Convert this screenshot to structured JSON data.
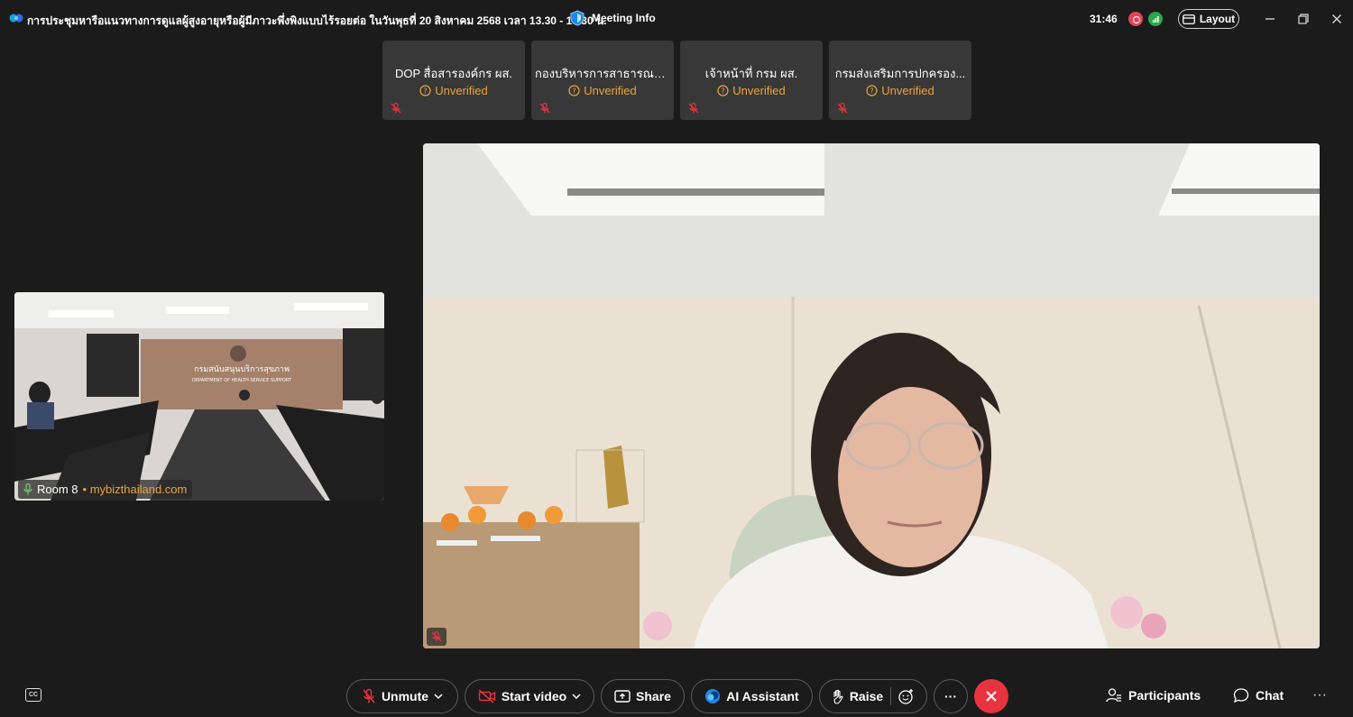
{
  "window": {
    "title": "การประชุมหารือแนวทางการดูแลผู้สูงอายุหรือผู้มีภาวะพึ่งพิงแบบไร้รอยต่อ ในวันพุธที่ 20 สิงหาคม 2568 เวลา 13.30 - 16.30 น.",
    "meeting_info_label": "Meeting Info",
    "timer": "31:46",
    "layout_label": "Layout",
    "minimize_icon": "minimize-icon",
    "restore_icon": "restore-icon",
    "close_icon": "close-icon"
  },
  "participants_strip": [
    {
      "name": "DOP สื่อสารองค์กร ผส.",
      "status": "Unverified"
    },
    {
      "name": "กองบริหารการสาธารณสุ...",
      "status": "Unverified"
    },
    {
      "name": "เจ้าหน้าที่ กรม ผส.",
      "status": "Unverified"
    },
    {
      "name": "กรมส่งเสริมการปกครอง...",
      "status": "Unverified"
    }
  ],
  "room_video": {
    "label": "Room 8",
    "watermark": "mybizthailand.com",
    "wall_sign_th": "กรมสนับสนุนบริการสุขภาพ",
    "wall_sign_en": "DEPARTMENT OF HEALTH SERVICE SUPPORT"
  },
  "controls": {
    "unmute": "Unmute",
    "start_video": "Start video",
    "share": "Share",
    "ai_assistant": "AI Assistant",
    "raise": "Raise",
    "more": "···",
    "participants": "Participants",
    "chat": "Chat",
    "more_right": "···"
  },
  "colors": {
    "background": "#1b1b1b",
    "tile": "#383838",
    "unverified": "#e9a53b",
    "leave": "#e7343f",
    "muted_mic": "#e7343f"
  }
}
